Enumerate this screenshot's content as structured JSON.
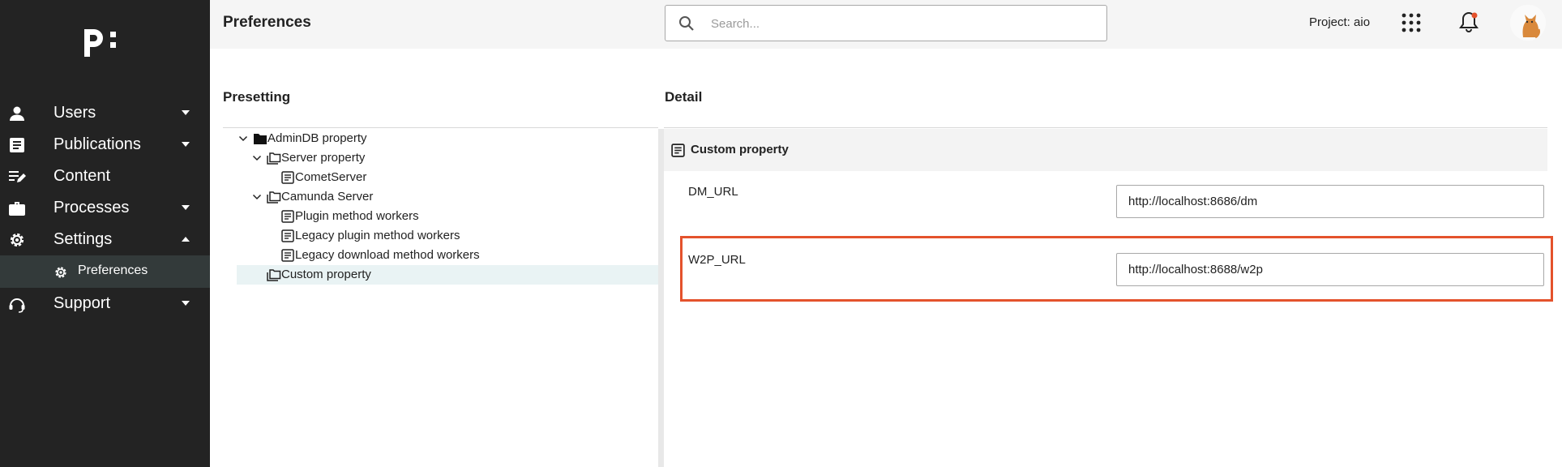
{
  "topbar": {
    "page_title": "Preferences",
    "search_placeholder": "Search...",
    "project_label": "Project: aio"
  },
  "sidebar": {
    "items": [
      {
        "label": "Users",
        "icon": "person-icon",
        "expand": "collapsed"
      },
      {
        "label": "Publications",
        "icon": "document-icon",
        "expand": "collapsed"
      },
      {
        "label": "Content",
        "icon": "edit-list-icon",
        "expand": "none"
      },
      {
        "label": "Processes",
        "icon": "briefcase-icon",
        "expand": "collapsed"
      },
      {
        "label": "Settings",
        "icon": "gear-icon",
        "expand": "expanded"
      },
      {
        "label": "Support",
        "icon": "headset-icon",
        "expand": "collapsed"
      }
    ],
    "sub_item": {
      "label": "Preferences",
      "icon": "gear-icon",
      "active": true
    }
  },
  "presetting": {
    "title": "Presetting",
    "tree": [
      {
        "label": "AdminDB property",
        "level": 0,
        "expanded": true,
        "icon": "folder-filled-icon"
      },
      {
        "label": "Server property",
        "level": 1,
        "expanded": true,
        "icon": "folder-stack-icon"
      },
      {
        "label": "CometServer",
        "level": 2,
        "icon": "document-icon"
      },
      {
        "label": "Camunda Server",
        "level": 1,
        "expanded": true,
        "icon": "folder-stack-icon"
      },
      {
        "label": "Plugin method workers",
        "level": 2,
        "icon": "document-icon"
      },
      {
        "label": "Legacy plugin method workers",
        "level": 2,
        "icon": "document-icon"
      },
      {
        "label": "Legacy download method workers",
        "level": 2,
        "icon": "document-icon"
      },
      {
        "label": "Custom property",
        "level": 1,
        "icon": "folder-stack-icon",
        "selected": true
      }
    ]
  },
  "detail": {
    "title": "Detail",
    "header": "Custom property",
    "properties": [
      {
        "label": "DM_URL",
        "value": "http://localhost:8686/dm"
      },
      {
        "label": "W2P_URL",
        "value": "http://localhost:8688/w2p",
        "highlighted": true
      }
    ]
  },
  "colors": {
    "sidebar_bg": "#232323",
    "sidebar_active_bg": "#333a3a",
    "highlight_border": "#e4522c",
    "tree_selected_bg": "#e9f3f4",
    "notification_dot": "#e4522c"
  }
}
